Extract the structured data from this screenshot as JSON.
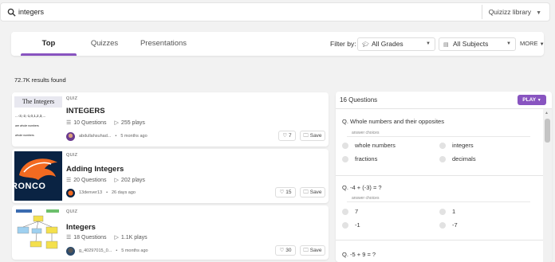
{
  "search": {
    "value": "integers",
    "library": "Quizizz library"
  },
  "tabs": [
    {
      "label": "Top"
    },
    {
      "label": "Quizzes"
    },
    {
      "label": "Presentations"
    }
  ],
  "filters": {
    "label": "Filter by:",
    "grades": "All Grades",
    "subjects": "All Subjects",
    "more": "MORE"
  },
  "results_count": "72.7K results found",
  "results": [
    {
      "type": "QUIZ",
      "title": "INTEGERS",
      "questions": "10 Questions",
      "plays": "255 plays",
      "author": "abdullahsuhad...",
      "time": "5 months ago",
      "likes": "7",
      "save": "Save",
      "thumb_title": "The Integers",
      "thumb_line1": "...-3,-2,-1,0,1,2,3,...",
      "thumb_line2": "are whole numbers",
      "thumb_line3": "whole numbers"
    },
    {
      "type": "QUIZ",
      "title": "Adding Integers",
      "questions": "20 Questions",
      "plays": "202 plays",
      "author": "13denver13",
      "time": "26 days ago",
      "likes": "15",
      "save": "Save",
      "thumb_text": "RONCO"
    },
    {
      "type": "QUIZ",
      "title": "Integers",
      "questions": "18 Questions",
      "plays": "1.1K plays",
      "author": "g_40297015_0...",
      "time": "5 months ago",
      "likes": "30",
      "save": "Save"
    }
  ],
  "preview": {
    "count": "16 Questions",
    "play": "PLAY",
    "answer_label": "answer choices",
    "questions": [
      {
        "text": "Q. Whole numbers and their opposites",
        "options": [
          "whole numbers",
          "integers",
          "fractions",
          "decimals"
        ]
      },
      {
        "text": "Q. -4 + (-3) = ?",
        "options": [
          "7",
          "1",
          "-1",
          "-7"
        ]
      },
      {
        "text": "Q. -5 + 9 = ?"
      }
    ]
  },
  "colors": {
    "accent": "#8854c0",
    "broncos_navy": "#0a2343",
    "broncos_orange": "#f26a21"
  }
}
